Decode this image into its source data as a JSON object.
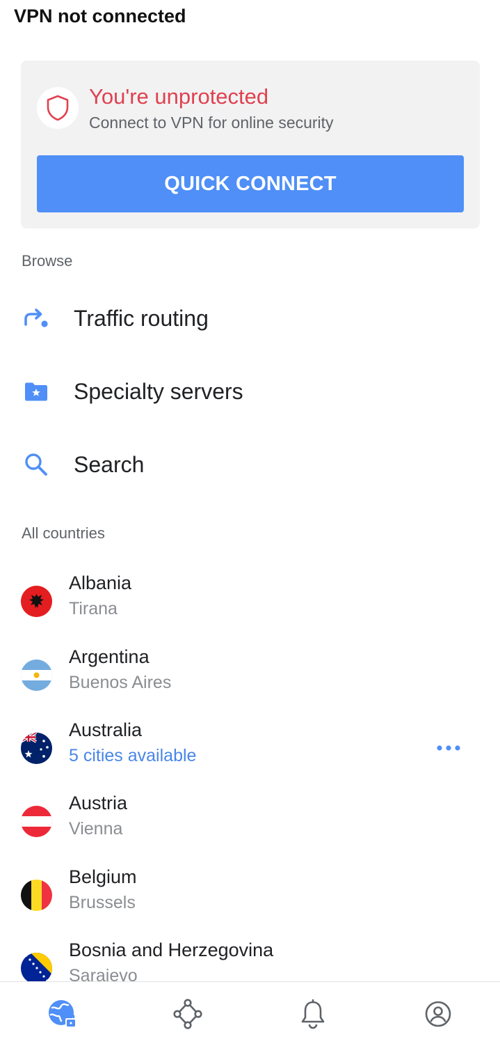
{
  "header": {
    "status": "VPN not connected"
  },
  "protection": {
    "title": "You're unprotected",
    "subtitle": "Connect to VPN for online security",
    "quick_connect_label": "QUICK CONNECT"
  },
  "browse": {
    "label": "Browse",
    "items": [
      {
        "label": "Traffic routing",
        "icon": "traffic-routing-icon"
      },
      {
        "label": "Specialty servers",
        "icon": "specialty-servers-folder-icon"
      },
      {
        "label": "Search",
        "icon": "search-icon"
      }
    ]
  },
  "countries": {
    "label": "All countries",
    "items": [
      {
        "name": "Albania",
        "city": "Tirana",
        "flag": "albania-flag-icon"
      },
      {
        "name": "Argentina",
        "city": "Buenos Aires",
        "flag": "argentina-flag-icon"
      },
      {
        "name": "Australia",
        "city": "5 cities available",
        "flag": "australia-flag-icon"
      },
      {
        "name": "Austria",
        "city": "Vienna",
        "flag": "austria-flag-icon"
      },
      {
        "name": "Belgium",
        "city": "Brussels",
        "flag": "belgium-flag-icon"
      },
      {
        "name": "Bosnia and Herzegovina",
        "city": "Sarajevo",
        "flag": "bosnia-flag-icon"
      }
    ]
  },
  "bottom_nav": {
    "items": [
      {
        "icon": "globe-lock-icon",
        "active": true
      },
      {
        "icon": "mesh-network-icon",
        "active": false
      },
      {
        "icon": "bell-icon",
        "active": false
      },
      {
        "icon": "profile-icon",
        "active": false
      }
    ]
  },
  "colors": {
    "accent": "#4f8ff7",
    "warning": "#e0414f",
    "card_background": "#f2f2f3",
    "link": "#4a86e8"
  }
}
